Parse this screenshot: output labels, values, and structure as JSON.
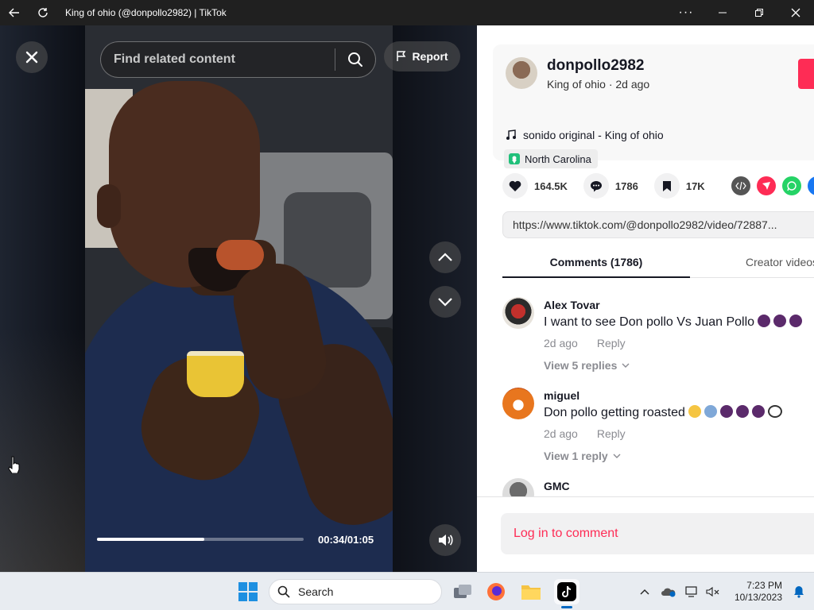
{
  "window": {
    "title": "King of ohio (@donpollo2982) | TikTok"
  },
  "video": {
    "search_placeholder": "Find related content",
    "report_label": "Report",
    "progress_fraction": 0.52,
    "time_display": "00:34/01:05"
  },
  "author": {
    "username": "donpollo2982",
    "subtitle": "King of ohio · 2d ago",
    "music": "sonido original - King of ohio",
    "location": "North Carolina"
  },
  "stats": {
    "likes": "164.5K",
    "comments": "1786",
    "saves": "17K"
  },
  "share_icons": [
    "embed-icon",
    "send-icon",
    "whatsapp-icon",
    "facebook-icon"
  ],
  "colors": {
    "brand": "#fe2c55",
    "whatsapp": "#25d366",
    "facebook": "#1877f2",
    "embed": "#555555"
  },
  "url": "https://www.tiktok.com/@donpollo2982/video/72887...",
  "tabs": {
    "comments": "Comments (1786)",
    "creator": "Creator videos"
  },
  "comments": [
    {
      "user": "Alex Tovar",
      "text": "I want to see Don pollo Vs Juan Pollo",
      "time": "2d ago",
      "reply": "Reply",
      "replies": "View 5 replies"
    },
    {
      "user": "miguel",
      "text": "Don pollo getting roasted",
      "time": "2d ago",
      "reply": "Reply",
      "replies": "View 1 reply"
    },
    {
      "user": "GMC"
    }
  ],
  "login": "Log in to comment",
  "taskbar": {
    "search_label": "Search",
    "time": "7:23 PM",
    "date": "10/13/2023"
  }
}
